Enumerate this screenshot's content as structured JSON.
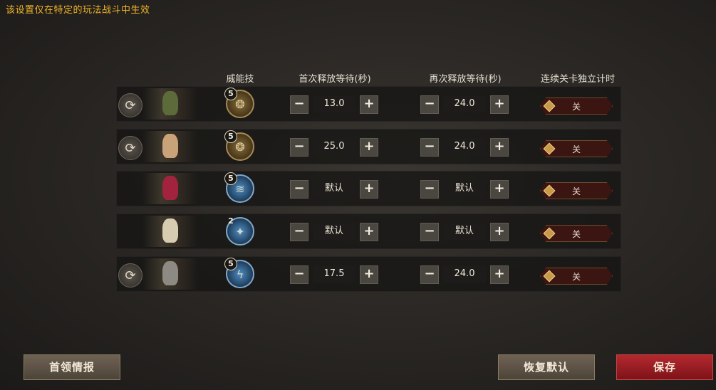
{
  "notice": "该设置仅在特定的玩法战斗中生效",
  "headers": {
    "skill": "威能技",
    "first_wait": "首次释放等待(秒)",
    "repeat_wait": "再次释放等待(秒)",
    "independent": "连续关卡独立计时"
  },
  "colors": {
    "notice": "#f0b429",
    "save": "#a3202a",
    "toggle_off": "#3a1512"
  },
  "rows": [
    {
      "has_reset": true,
      "skill_level": "5",
      "skill_style": "gold",
      "first_wait": "13.0",
      "repeat_wait": "24.0",
      "toggle": "关"
    },
    {
      "has_reset": true,
      "skill_level": "5",
      "skill_style": "gold",
      "first_wait": "25.0",
      "repeat_wait": "24.0",
      "toggle": "关"
    },
    {
      "has_reset": false,
      "skill_level": "5",
      "skill_style": "blue",
      "first_wait": "默认",
      "repeat_wait": "默认",
      "toggle": "关"
    },
    {
      "has_reset": false,
      "skill_level": "2",
      "skill_style": "blue",
      "first_wait": "默认",
      "repeat_wait": "默认",
      "toggle": "关"
    },
    {
      "has_reset": true,
      "skill_level": "5",
      "skill_style": "blue",
      "first_wait": "17.5",
      "repeat_wait": "24.0",
      "toggle": "关"
    }
  ],
  "icons": {
    "reset": "refresh-icon",
    "minus": "minus-icon",
    "plus": "plus-icon"
  },
  "buttons": {
    "leader_info": "首领情报",
    "restore_default": "恢复默认",
    "save": "保存"
  }
}
